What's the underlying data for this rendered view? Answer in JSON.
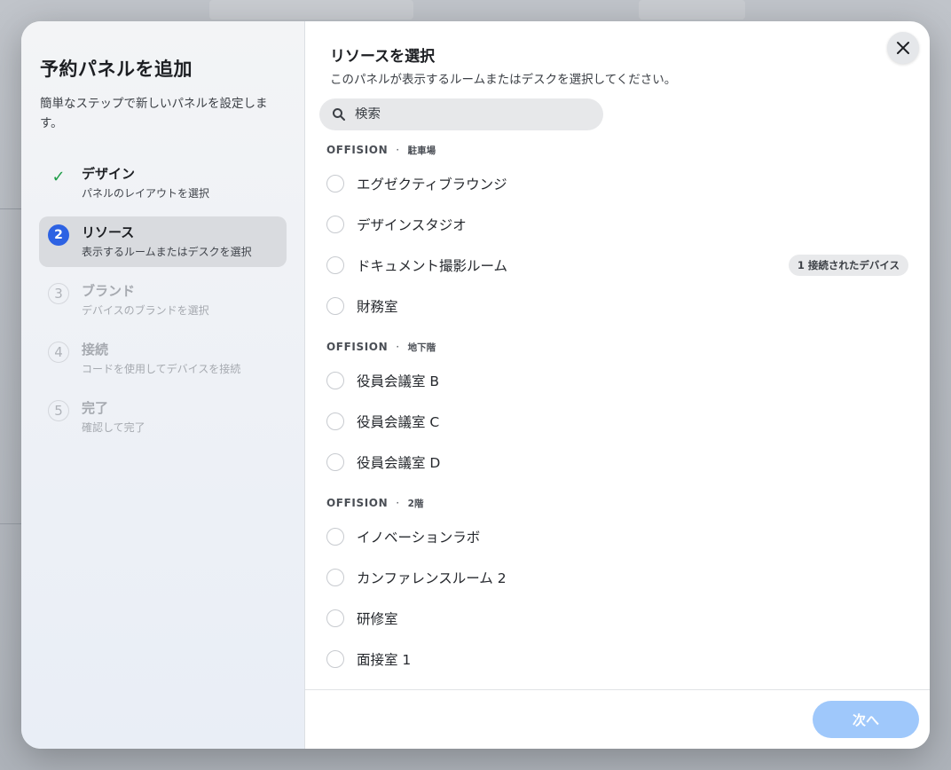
{
  "sidebar": {
    "title": "予約パネルを追加",
    "subtitle": "簡単なステップで新しいパネルを設定します。",
    "steps": [
      {
        "badge": "✓",
        "title": "デザイン",
        "desc": "パネルのレイアウトを選択",
        "state": "done"
      },
      {
        "badge": "2",
        "title": "リソース",
        "desc": "表示するルームまたはデスクを選択",
        "state": "current"
      },
      {
        "badge": "3",
        "title": "ブランド",
        "desc": "デバイスのブランドを選択",
        "state": "pending"
      },
      {
        "badge": "4",
        "title": "接続",
        "desc": "コードを使用してデバイスを接続",
        "state": "pending"
      },
      {
        "badge": "5",
        "title": "完了",
        "desc": "確認して完了",
        "state": "pending"
      }
    ]
  },
  "main": {
    "title": "リソースを選択",
    "subtitle": "このパネルが表示するルームまたはデスクを選択してください。",
    "search_placeholder": "検索",
    "groups": [
      {
        "building": "OFFISION",
        "separator": "·",
        "floor": "駐車場",
        "items": [
          {
            "label": "エグゼクティブラウンジ"
          },
          {
            "label": "デザインスタジオ"
          },
          {
            "label": "ドキュメント撮影ルーム",
            "badge": "1 接続されたデバイス"
          },
          {
            "label": "財務室"
          }
        ]
      },
      {
        "building": "OFFISION",
        "separator": "·",
        "floor": "地下階",
        "items": [
          {
            "label": "役員会議室 B"
          },
          {
            "label": "役員会議室 C"
          },
          {
            "label": "役員会議室 D"
          }
        ]
      },
      {
        "building": "OFFISION",
        "separator": "·",
        "floor": "2階",
        "items": [
          {
            "label": "イノベーションラボ"
          },
          {
            "label": "カンファレンスルーム 2"
          },
          {
            "label": "研修室"
          },
          {
            "label": "面接室 1"
          }
        ]
      }
    ],
    "next_label": "次へ"
  },
  "colors": {
    "accent": "#2d62e3",
    "done_check": "#1f9d48",
    "next_button": "#9fc8fb"
  }
}
